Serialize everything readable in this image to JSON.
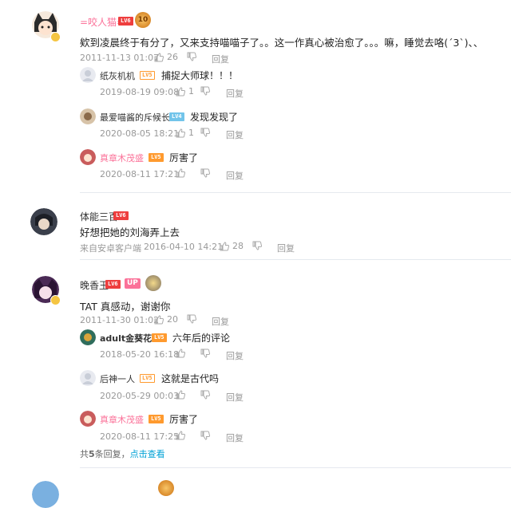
{
  "comments": [
    {
      "user": "=咬人猫=",
      "level": "LV6",
      "badge": "10",
      "text": "欸到凌晨终于有分了，又来支持喵喵子了。。这一作真心被治愈了。。。嘛，睡觉去咯(ˊ3ˋ)、、",
      "time": "2011-11-13 01:07",
      "likes": "26",
      "reply_label": "回复",
      "replies": [
        {
          "user": "纸灰机机",
          "level": "LV5",
          "text": "捕捉大师球！！！",
          "time": "2019-08-19 09:08",
          "likes": "1",
          "reply_label": "回复"
        },
        {
          "user": "最爱喵酱的斥候长",
          "level": "LV4",
          "text": "发现发现了",
          "time": "2020-08-05 18:21",
          "likes": "1",
          "reply_label": "回复"
        },
        {
          "user": "真章木茂盛",
          "level": "LV5",
          "text": "厉害了",
          "time": "2020-08-11 17:21",
          "likes": "",
          "reply_label": "回复"
        }
      ]
    },
    {
      "user": "体能三百",
      "level": "LV6",
      "text": "好想把她的刘海弄上去",
      "source": "来自安卓客户端",
      "time": "2016-04-10 14:21",
      "likes": "28",
      "reply_label": "回复"
    },
    {
      "user": "晚香玉",
      "level": "LV6",
      "up_badge": "UP",
      "text": "TAT 真感动，谢谢你",
      "time": "2011-11-30 01:02",
      "likes": "20",
      "reply_label": "回复",
      "replies": [
        {
          "user": "adult金葵花",
          "level": "LV5",
          "text": "六年后的评论",
          "time": "2018-05-20 16:18",
          "likes": "",
          "reply_label": "回复"
        },
        {
          "user": "后神一人",
          "level": "LV5",
          "text": "这就是古代吗",
          "time": "2020-05-29 00:03",
          "likes": "",
          "reply_label": "回复"
        },
        {
          "user": "真章木茂盛",
          "level": "LV5",
          "text": "厉害了",
          "time": "2020-08-11 17:25",
          "likes": "",
          "reply_label": "回复"
        }
      ],
      "more_prefix": "共",
      "more_count": "5",
      "more_suffix": "条回复，",
      "more_link": "点击查看"
    }
  ],
  "colors": {
    "pink_name": "#fb7299",
    "link": "#00a1d6",
    "meta": "#999999"
  }
}
